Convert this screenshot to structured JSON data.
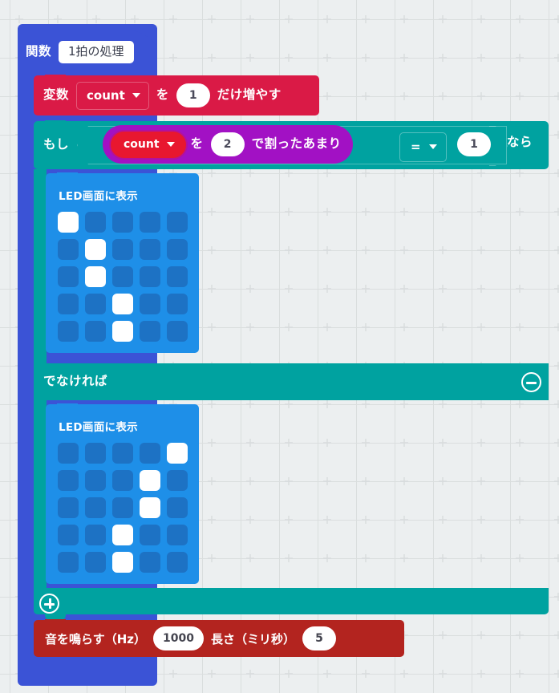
{
  "editor": {
    "canvas_background": "#eceff0",
    "grid_mark": "plus"
  },
  "function_block": {
    "name": "function-definition",
    "color": "#3b53d6",
    "keyword": "関数",
    "function_name": "1拍の処理"
  },
  "variable_block": {
    "name": "change-variable-by",
    "color": "#da1a46",
    "keyword": "変数",
    "variable": "count",
    "particle": "を",
    "amount": "1",
    "suffix": "だけ増やす"
  },
  "if_block": {
    "name": "if-else",
    "color": "#00a2a0",
    "if_label": "もし",
    "then_label": "なら",
    "else_label": "でなければ",
    "comparison": {
      "operator": "=",
      "value": "1"
    },
    "minus_icon": "minus-circle-icon",
    "plus_icon": "plus-circle-icon"
  },
  "modulo_block": {
    "name": "modulo-expression",
    "color": "#a211c4",
    "variable": "count",
    "particle": "を",
    "divisor": "2",
    "suffix": "で割ったあまり"
  },
  "led_block_1": {
    "name": "show-leds-1",
    "color": "#1e8fe8",
    "title": "LED画面に表示",
    "pattern": [
      [
        1,
        0,
        0,
        0,
        0
      ],
      [
        0,
        1,
        0,
        0,
        0
      ],
      [
        0,
        1,
        0,
        0,
        0
      ],
      [
        0,
        0,
        1,
        0,
        0
      ],
      [
        0,
        0,
        1,
        0,
        0
      ]
    ]
  },
  "led_block_2": {
    "name": "show-leds-2",
    "color": "#1e8fe8",
    "title": "LED画面に表示",
    "pattern": [
      [
        0,
        0,
        0,
        0,
        1
      ],
      [
        0,
        0,
        0,
        1,
        0
      ],
      [
        0,
        0,
        0,
        1,
        0
      ],
      [
        0,
        0,
        1,
        0,
        0
      ],
      [
        0,
        0,
        1,
        0,
        0
      ]
    ]
  },
  "sound_block": {
    "name": "play-tone",
    "color": "#b3241f",
    "frequency_label": "音を鳴らす（Hz）",
    "frequency_value": "1000",
    "duration_label": "長さ（ミリ秒）",
    "duration_value": "5"
  }
}
